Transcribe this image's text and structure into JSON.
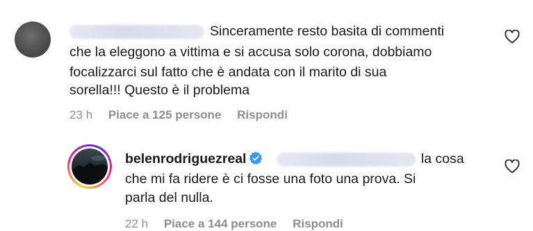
{
  "comment1": {
    "lines": [
      "Sinceramente resto basita di commenti",
      "che la eleggono a vittima e si accusa solo corona, dobbiamo",
      "focalizzarci sul fatto che è andata con il marito di sua",
      "sorella!!! Questo è il problema"
    ],
    "time": "23 h",
    "likes": "Piace a 125 persone",
    "reply": "Rispondi"
  },
  "comment2": {
    "username": "belenrodriguezreal",
    "first_line_tail": "la cosa",
    "lines": [
      "che mi fa ridere è ci fosse una foto una prova. Si",
      "parla del nulla."
    ],
    "time": "22 h",
    "likes": "Piace a 144 persone",
    "reply": "Rispondi"
  },
  "colors": {
    "text": "#1a1a1a",
    "meta": "#8e8e8e",
    "verified": "#3897f0"
  },
  "icons": [
    "heart-icon",
    "verified-badge-icon"
  ]
}
